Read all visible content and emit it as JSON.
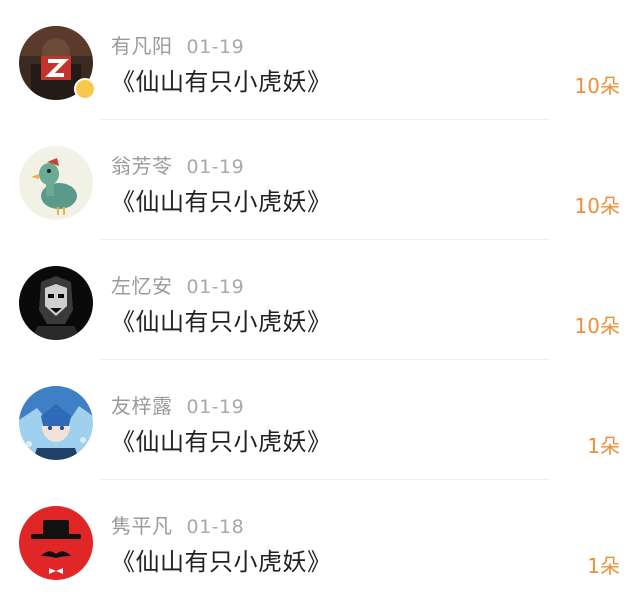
{
  "colors": {
    "accent": "#ef8f3a",
    "name_gray": "#9a9a9a",
    "title_text": "#222222",
    "divider": "#efefef"
  },
  "entries": [
    {
      "name": "有凡阳",
      "date": "01-19",
      "title": "《仙山有只小虎妖》",
      "amount": "10朵",
      "avatar_icon": "dark-z-avatar-icon",
      "verified": true
    },
    {
      "name": "翁芳苓",
      "date": "01-19",
      "title": "《仙山有只小虎妖》",
      "amount": "10朵",
      "avatar_icon": "duck-avatar-icon",
      "verified": false
    },
    {
      "name": "左忆安",
      "date": "01-19",
      "title": "《仙山有只小虎妖》",
      "amount": "10朵",
      "avatar_icon": "skull-mask-avatar-icon",
      "verified": false
    },
    {
      "name": "友梓露",
      "date": "01-19",
      "title": "《仙山有只小虎妖》",
      "amount": "1朵",
      "avatar_icon": "anime-boy-avatar-icon",
      "verified": false
    },
    {
      "name": "隽平凡",
      "date": "01-18",
      "title": "《仙山有只小虎妖》",
      "amount": "1朵",
      "avatar_icon": "hat-mustache-avatar-icon",
      "verified": false
    }
  ]
}
